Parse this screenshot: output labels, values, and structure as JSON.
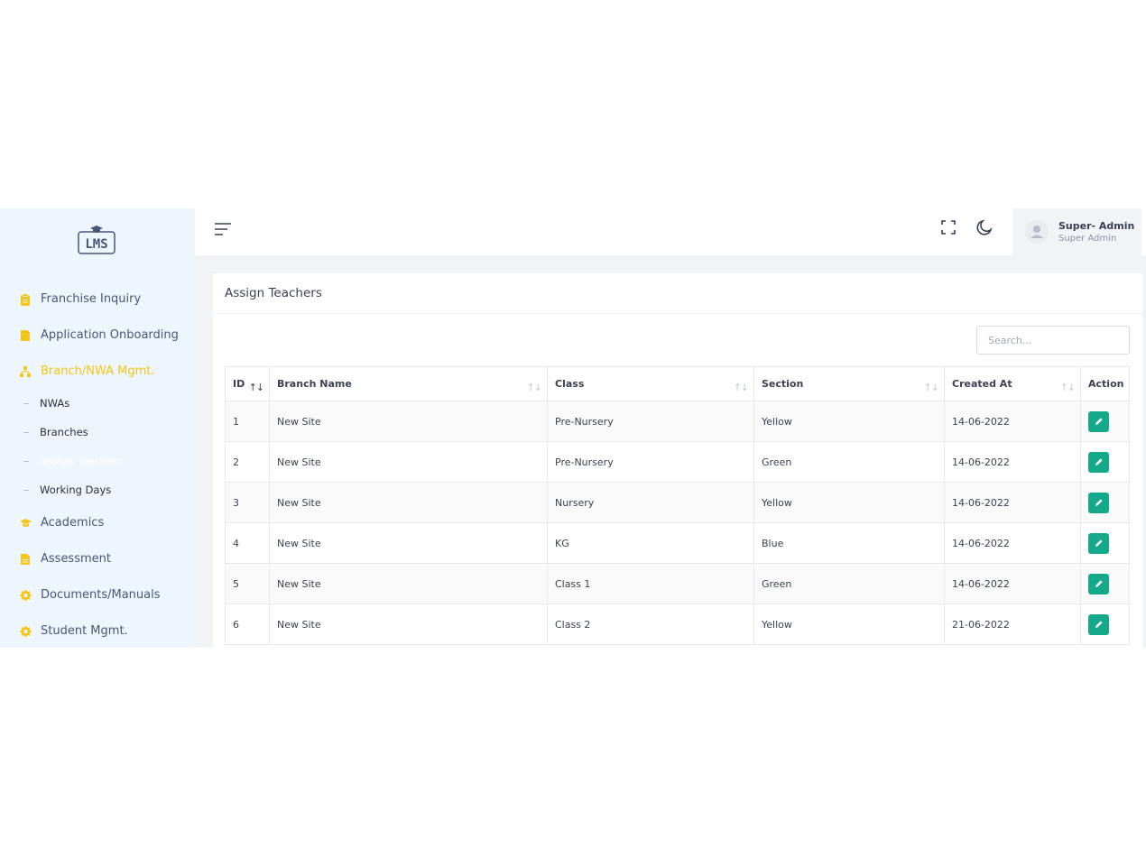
{
  "logo": {
    "text": "LMS"
  },
  "sidebar": {
    "items": [
      {
        "label": "Franchise Inquiry",
        "icon": "clipboard-icon",
        "color": "#f5c518"
      },
      {
        "label": "Application Onboarding",
        "icon": "file-icon",
        "color": "#f5c518"
      },
      {
        "label": "Branch/NWA Mgmt.",
        "icon": "sitemap-icon",
        "color": "#f5c518",
        "active": true,
        "children": [
          {
            "label": "NWAs"
          },
          {
            "label": "Branches"
          },
          {
            "label": "Assign Teachers",
            "current": true
          },
          {
            "label": "Working Days"
          }
        ]
      },
      {
        "label": "Academics",
        "icon": "graduation-cap-icon",
        "color": "#f5c518"
      },
      {
        "label": "Assessment",
        "icon": "document-icon",
        "color": "#f5c518"
      },
      {
        "label": "Documents/Manuals",
        "icon": "gear-icon",
        "color": "#f5c518"
      },
      {
        "label": "Student Mgmt.",
        "icon": "gear-icon",
        "color": "#f5c518"
      }
    ]
  },
  "topbar": {
    "user_name": "Super- Admin",
    "user_role": "Super Admin"
  },
  "card": {
    "title": "Assign Teachers",
    "search_placeholder": "Search..."
  },
  "table": {
    "columns": [
      "ID",
      "Branch Name",
      "Class",
      "Section",
      "Created At",
      "Action"
    ],
    "rows": [
      {
        "id": "1",
        "branch": "New Site",
        "class": "Pre-Nursery",
        "section": "Yellow",
        "created": "14-06-2022"
      },
      {
        "id": "2",
        "branch": "New Site",
        "class": "Pre-Nursery",
        "section": "Green",
        "created": "14-06-2022"
      },
      {
        "id": "3",
        "branch": "New Site",
        "class": "Nursery",
        "section": "Yellow",
        "created": "14-06-2022"
      },
      {
        "id": "4",
        "branch": "New Site",
        "class": "KG",
        "section": "Blue",
        "created": "14-06-2022"
      },
      {
        "id": "5",
        "branch": "New Site",
        "class": "Class 1",
        "section": "Green",
        "created": "14-06-2022"
      },
      {
        "id": "6",
        "branch": "New Site",
        "class": "Class 2",
        "section": "Yellow",
        "created": "21-06-2022"
      }
    ]
  },
  "colors": {
    "accent": "#f5c518",
    "action": "#14a98a",
    "sidebar_bg": "#eef6fd"
  }
}
